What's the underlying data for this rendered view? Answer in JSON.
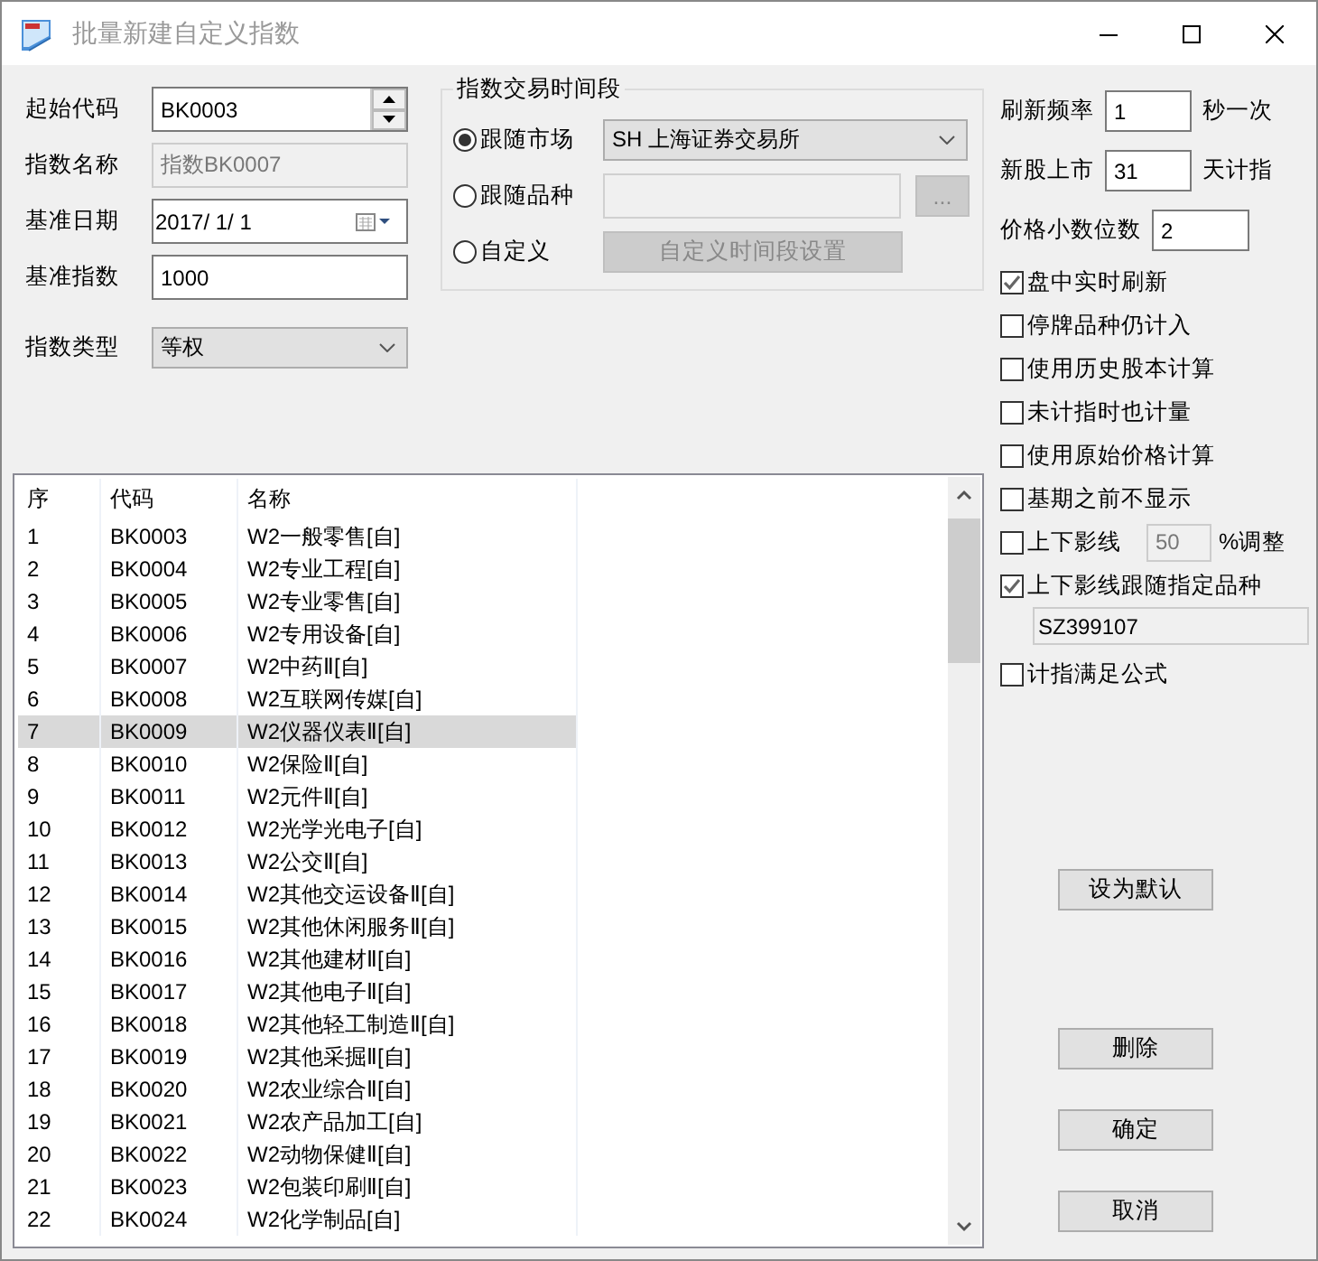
{
  "window": {
    "title": "批量新建自定义指数"
  },
  "form": [
    {
      "kind": "spinner",
      "label": "起始代码",
      "value": "BK0003"
    },
    {
      "kind": "text",
      "label": "指数名称",
      "value": "指数BK0007",
      "disabled": true
    },
    {
      "kind": "date",
      "label": "基准日期",
      "value": "2017/  1/  1"
    },
    {
      "kind": "text",
      "label": "基准指数",
      "value": "1000",
      "disabled": false
    },
    {
      "kind": "select",
      "label": "指数类型",
      "value": "等权"
    }
  ],
  "trading_period": {
    "title": "指数交易时间段",
    "options": [
      {
        "label": "跟随市场",
        "selected": true,
        "kind": "select",
        "value": "SH 上海证券交易所"
      },
      {
        "label": "跟随品种",
        "selected": false,
        "kind": "browse",
        "button": "..."
      },
      {
        "label": "自定义",
        "selected": false,
        "kind": "button",
        "button": "自定义时间段设置"
      }
    ]
  },
  "settings": [
    {
      "label": "刷新频率",
      "value": "1",
      "unit": "秒一次"
    },
    {
      "label": "新股上市",
      "value": "31",
      "unit": "天计指"
    },
    {
      "label": "价格小数位数",
      "value": "2"
    }
  ],
  "options": [
    {
      "kind": "check",
      "label": "盘中实时刷新",
      "checked": true
    },
    {
      "kind": "check",
      "label": "停牌品种仍计入",
      "checked": false
    },
    {
      "kind": "check",
      "label": "使用历史股本计算",
      "checked": false
    },
    {
      "kind": "check",
      "label": "未计指时也计量",
      "checked": false
    },
    {
      "kind": "check",
      "label": "使用原始价格计算",
      "checked": false
    },
    {
      "kind": "check",
      "label": "基期之前不显示",
      "checked": false
    },
    {
      "kind": "check-field",
      "label": "上下影线",
      "checked": false,
      "value": "50",
      "unit": "%调整"
    },
    {
      "kind": "check-below",
      "label": "上下影线跟随指定品种",
      "checked": true,
      "value": "SZ399107"
    },
    {
      "kind": "check",
      "label": "计指满足公式",
      "checked": false
    }
  ],
  "buttons": {
    "default": "设为默认",
    "actions": [
      "删除",
      "确定",
      "取消"
    ]
  },
  "table": {
    "columns": [
      "序",
      "代码",
      "名称"
    ],
    "rows": [
      {
        "cells": [
          "1",
          "BK0003",
          "W2一般零售[自]"
        ],
        "selected": false
      },
      {
        "cells": [
          "2",
          "BK0004",
          "W2专业工程[自]"
        ],
        "selected": false
      },
      {
        "cells": [
          "3",
          "BK0005",
          "W2专业零售[自]"
        ],
        "selected": false
      },
      {
        "cells": [
          "4",
          "BK0006",
          "W2专用设备[自]"
        ],
        "selected": false
      },
      {
        "cells": [
          "5",
          "BK0007",
          "W2中药Ⅱ[自]"
        ],
        "selected": false
      },
      {
        "cells": [
          "6",
          "BK0008",
          "W2互联网传媒[自]"
        ],
        "selected": false
      },
      {
        "cells": [
          "7",
          "BK0009",
          "W2仪器仪表Ⅱ[自]"
        ],
        "selected": true
      },
      {
        "cells": [
          "8",
          "BK0010",
          "W2保险Ⅱ[自]"
        ],
        "selected": false
      },
      {
        "cells": [
          "9",
          "BK0011",
          "W2元件Ⅱ[自]"
        ],
        "selected": false
      },
      {
        "cells": [
          "10",
          "BK0012",
          "W2光学光电子[自]"
        ],
        "selected": false
      },
      {
        "cells": [
          "11",
          "BK0013",
          "W2公交Ⅱ[自]"
        ],
        "selected": false
      },
      {
        "cells": [
          "12",
          "BK0014",
          "W2其他交运设备Ⅱ[自]"
        ],
        "selected": false
      },
      {
        "cells": [
          "13",
          "BK0015",
          "W2其他休闲服务Ⅱ[自]"
        ],
        "selected": false
      },
      {
        "cells": [
          "14",
          "BK0016",
          "W2其他建材Ⅱ[自]"
        ],
        "selected": false
      },
      {
        "cells": [
          "15",
          "BK0017",
          "W2其他电子Ⅱ[自]"
        ],
        "selected": false
      },
      {
        "cells": [
          "16",
          "BK0018",
          "W2其他轻工制造Ⅱ[自]"
        ],
        "selected": false
      },
      {
        "cells": [
          "17",
          "BK0019",
          "W2其他采掘Ⅱ[自]"
        ],
        "selected": false
      },
      {
        "cells": [
          "18",
          "BK0020",
          "W2农业综合Ⅱ[自]"
        ],
        "selected": false
      },
      {
        "cells": [
          "19",
          "BK0021",
          "W2农产品加工[自]"
        ],
        "selected": false
      },
      {
        "cells": [
          "20",
          "BK0022",
          "W2动物保健Ⅱ[自]"
        ],
        "selected": false
      },
      {
        "cells": [
          "21",
          "BK0023",
          "W2包装印刷Ⅱ[自]"
        ],
        "selected": false
      },
      {
        "cells": [
          "22",
          "BK0024",
          "W2化学制品[自]"
        ],
        "selected": false
      }
    ]
  }
}
